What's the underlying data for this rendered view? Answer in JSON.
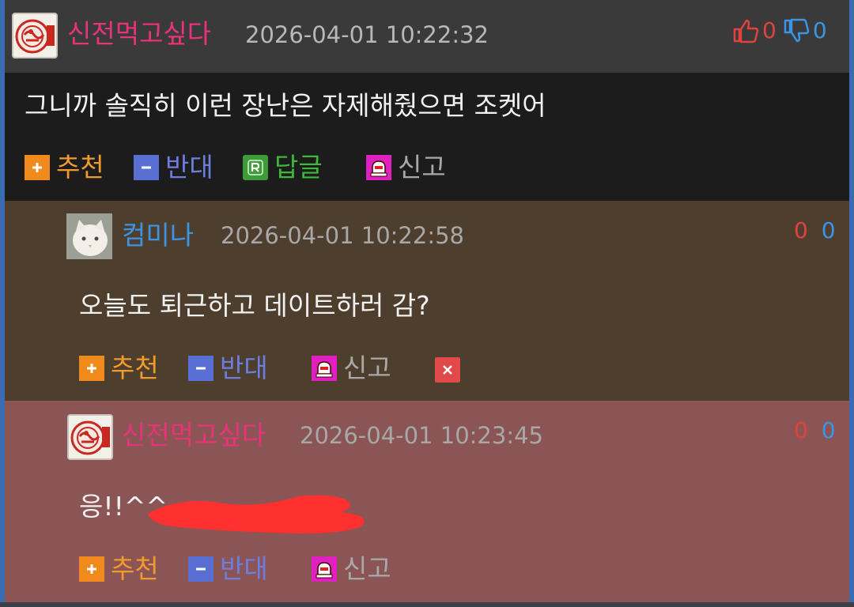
{
  "comments": [
    {
      "nickname": "신전먹고싶다",
      "timestamp": "2026-04-01 10:22:32",
      "upvotes": "0",
      "downvotes": "0",
      "text": "그니까 솔직히 이런 장난은 자제해줬으면 조켓어",
      "actions": {
        "recommend": "추천",
        "oppose": "반대",
        "reply": "답글",
        "report": "신고"
      }
    },
    {
      "nickname": "컴미나",
      "timestamp": "2026-04-01 10:22:58",
      "upvotes": "0",
      "downvotes": "0",
      "text": "오늘도 퇴근하고 데이트하러 감?",
      "actions": {
        "recommend": "추천",
        "oppose": "반대",
        "report": "신고"
      }
    },
    {
      "nickname": "신전먹고싶다",
      "timestamp": "2026-04-01 10:23:45",
      "upvotes": "0",
      "downvotes": "0",
      "text": "응!!^^",
      "actions": {
        "recommend": "추천",
        "oppose": "반대",
        "report": "신고"
      }
    }
  ],
  "colors": {
    "header_bg": "#3a3a3a",
    "comment1_bg": "#1c1c1c",
    "comment2_bg": "#4e3e2d",
    "comment3_bg": "#8b5555",
    "nickname_pink": "#e8337a",
    "nickname_blue": "#3b94e6",
    "upvote_red": "#e0433e",
    "downvote_blue": "#3b94e6",
    "recommend_orange": "#f08a1c",
    "oppose_blue": "#5a6fd4",
    "reply_green": "#3f9a3a",
    "report_magenta": "#e020c0",
    "redaction_red": "#ff3030"
  },
  "icons": {
    "thumbs_up": "thumbs-up-icon",
    "thumbs_down": "thumbs-down-icon",
    "plus": "plus-icon",
    "minus": "minus-icon",
    "reply": "reply-icon",
    "report": "siren-icon",
    "delete": "delete-icon"
  }
}
